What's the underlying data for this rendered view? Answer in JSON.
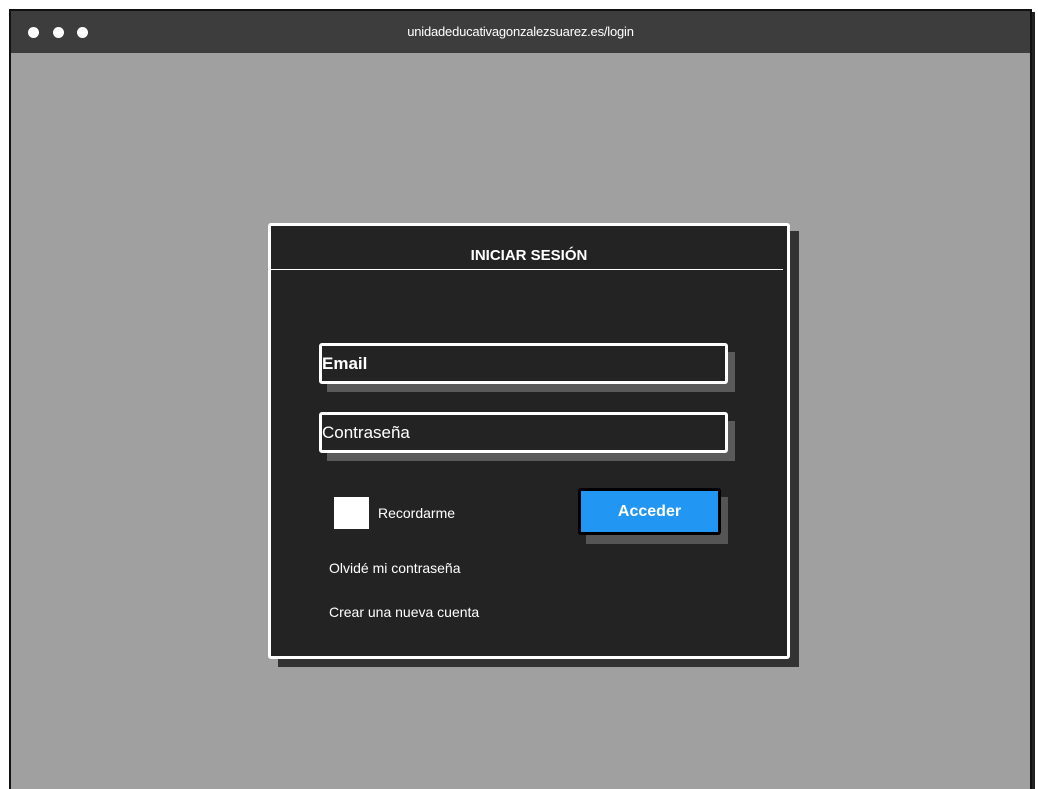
{
  "browser": {
    "url": "unidadeducativagonzalezsuarez.es/login"
  },
  "dialog": {
    "title": "INICIAR SESIÓN",
    "email_placeholder": "Email",
    "password_placeholder": "Contraseña",
    "remember_label": "Recordarme",
    "remember_checked": false,
    "submit_label": "Acceder",
    "forgot_link": "Olvidé mi contraseña",
    "register_link": "Crear una nueva cuenta"
  },
  "colors": {
    "page_background": "#a0a0a0",
    "titlebar": "#3d3d3d",
    "dialog_background": "#232323",
    "accent_button": "#2196f3"
  }
}
